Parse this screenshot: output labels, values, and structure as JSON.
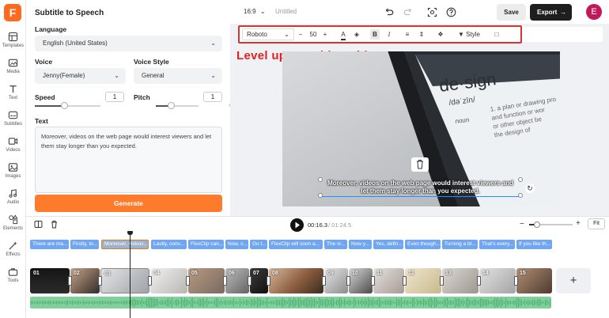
{
  "app": {
    "logo_letter": "F"
  },
  "rail": [
    {
      "label": "Templates",
      "icon": "templates-icon"
    },
    {
      "label": "Media",
      "icon": "media-icon"
    },
    {
      "label": "Text",
      "icon": "text-icon"
    },
    {
      "label": "Subtitles",
      "icon": "subtitles-icon"
    },
    {
      "label": "Videos",
      "icon": "videos-icon"
    },
    {
      "label": "Images",
      "icon": "images-icon"
    },
    {
      "label": "Audio",
      "icon": "audio-icon"
    },
    {
      "label": "Elements",
      "icon": "elements-icon"
    },
    {
      "label": "Effects",
      "icon": "effects-icon"
    },
    {
      "label": "Tools",
      "icon": "tools-icon"
    }
  ],
  "panel": {
    "title": "Subtitle to Speech",
    "language_label": "Language",
    "language_value": "English (United States)",
    "voice_label": "Voice",
    "voice_value": "Jenny(Female)",
    "voice_style_label": "Voice Style",
    "voice_style_value": "General",
    "speed_label": "Speed",
    "speed_value": "1",
    "speed_level": 0.45,
    "pitch_label": "Pitch",
    "pitch_value": "1",
    "pitch_level": 0.35,
    "text_label": "Text",
    "text_value": "Moreover, videos on the web page would interest viewers and let them stay longer than you expected.",
    "generate_label": "Generate"
  },
  "topbar": {
    "aspect": "16:9",
    "title_placeholder": "Untitled",
    "save_label": "Save",
    "export_label": "Export",
    "avatar_letter": "E"
  },
  "toolbar": {
    "font": "Roboto",
    "size": "50",
    "minus": "−",
    "plus": "+",
    "style_label": "Style"
  },
  "headline": "Level up your blog video",
  "preview": {
    "subtitle_line1": "Moreover, videos on the web page would interest viewers and",
    "subtitle_line2": "let them stay longer than you expected.",
    "phone_word": "de·sign",
    "phone_phonetic": "/dəˈzīn/",
    "phone_pos": "noun",
    "phone_def": [
      "1. a plan or drawing pro",
      "and function or wor",
      "or other object be",
      "the design of"
    ]
  },
  "playback": {
    "current": "00:16.3",
    "total": "/ 01:24.5",
    "fit_label": "Fit"
  },
  "captions": [
    "There are ma...",
    "Firstly, to...",
    "Moreover, videos...",
    "Lastly, conv...",
    "FlexClip can...",
    "Now, c...",
    "Go t...",
    "FlexClip will soon a...",
    "The vi...",
    "Now y...",
    "Yes, defin...",
    "Even though...",
    "Turning a bl...",
    "That's every...",
    "If you like th..."
  ],
  "clips": [
    "01",
    "02",
    "03",
    "04",
    "05",
    "06",
    "07",
    "08",
    "09",
    "10",
    "11",
    "12",
    "13",
    "14",
    "15"
  ]
}
